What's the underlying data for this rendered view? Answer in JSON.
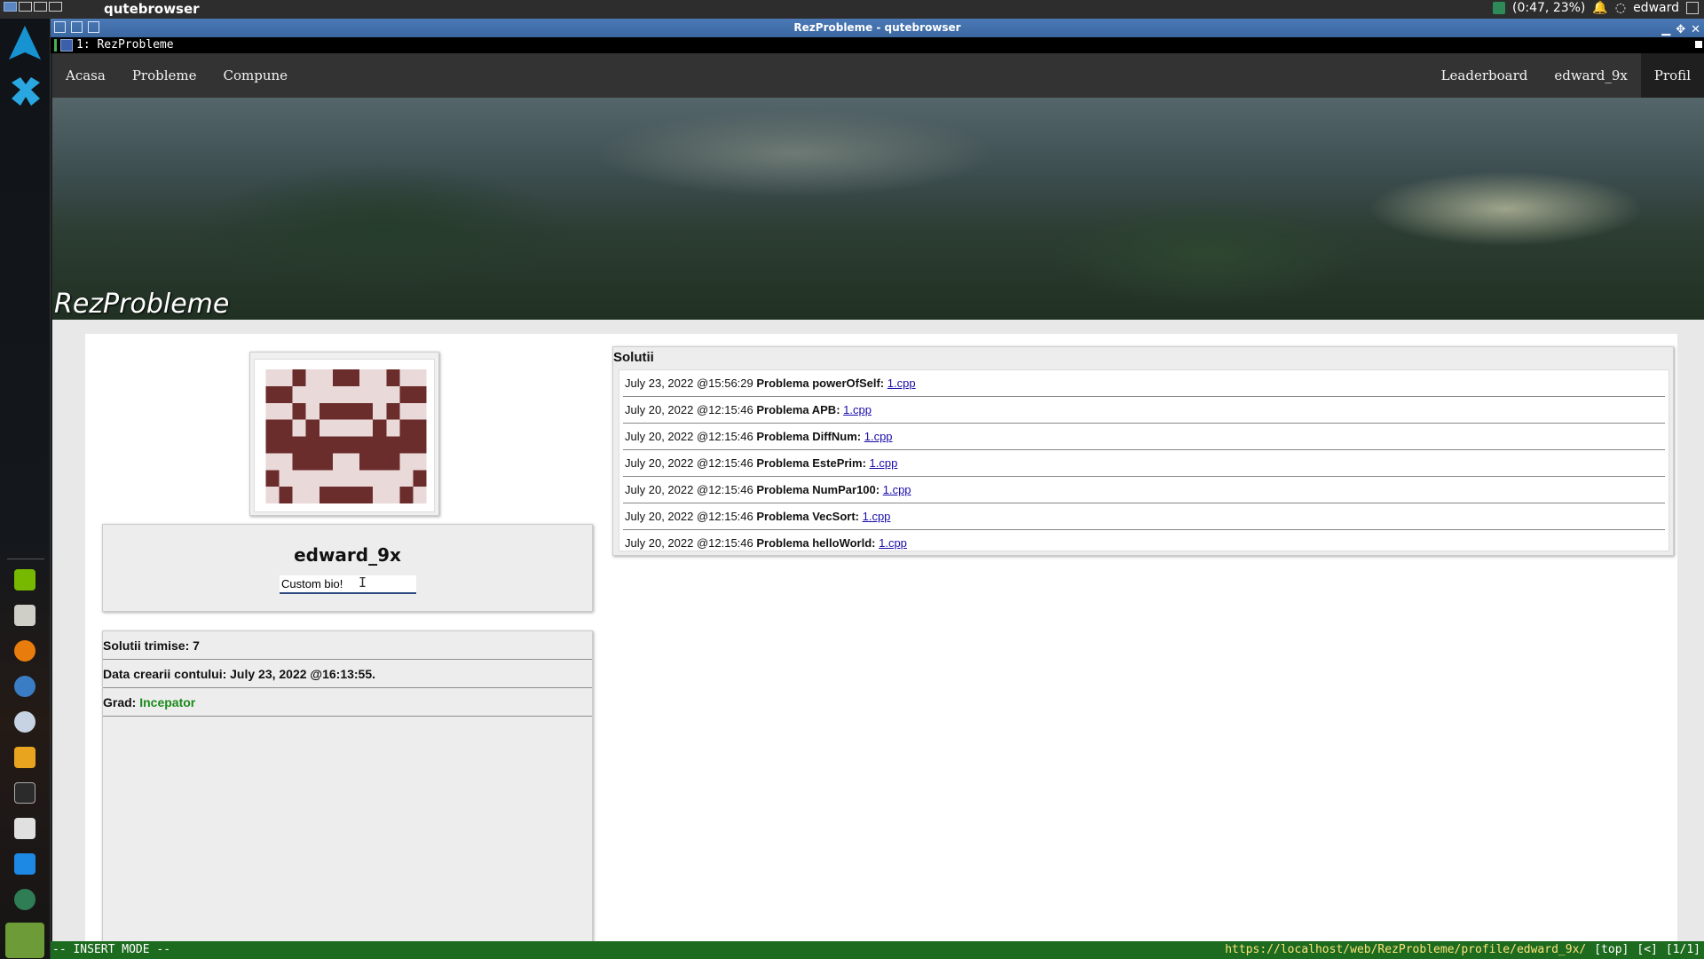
{
  "system": {
    "app_name": "qutebrowser",
    "battery": "(0:47, 23%)",
    "user": "edward"
  },
  "window": {
    "title": "RezProbleme - qutebrowser",
    "tab_label": "1: RezProbleme"
  },
  "nav": {
    "left": [
      "Acasa",
      "Probleme",
      "Compune"
    ],
    "right": [
      "Leaderboard",
      "edward_9x",
      "Profil"
    ]
  },
  "banner": {
    "site_title": "RezProbleme"
  },
  "profile": {
    "username": "edward_9x",
    "bio_value": "Custom bio!",
    "stats": {
      "solutions_label": "Solutii trimise: 7",
      "created_label": "Data crearii contului: July 23, 2022 @16:13:55.",
      "grade_label": "Grad:",
      "grade_value": "Incepator"
    }
  },
  "solutions": {
    "heading": "Solutii",
    "items": [
      {
        "time": "July 23, 2022 @15:56:29",
        "problem": "Problema powerOfSelf:",
        "file": "1.cpp"
      },
      {
        "time": "July 20, 2022 @12:15:46",
        "problem": "Problema APB:",
        "file": "1.cpp"
      },
      {
        "time": "July 20, 2022 @12:15:46",
        "problem": "Problema DiffNum:",
        "file": "1.cpp"
      },
      {
        "time": "July 20, 2022 @12:15:46",
        "problem": "Problema EstePrim:",
        "file": "1.cpp"
      },
      {
        "time": "July 20, 2022 @12:15:46",
        "problem": "Problema NumPar100:",
        "file": "1.cpp"
      },
      {
        "time": "July 20, 2022 @12:15:46",
        "problem": "Problema VecSort:",
        "file": "1.cpp"
      },
      {
        "time": "July 20, 2022 @12:15:46",
        "problem": "Problema helloWorld:",
        "file": "1.cpp"
      }
    ]
  },
  "statusbar": {
    "mode": "-- INSERT MODE --",
    "url": "https://localhost/web/RezProbleme/profile/edward_9x/",
    "position": "[top]",
    "history": "[<]",
    "tabs": "[1/1]"
  },
  "colors": {
    "accent_green": "#1b8a1b",
    "titlebar_blue": "#4a79b6",
    "statusbar_green": "#1c6b1f",
    "avatar_color": "#6b2d2b"
  },
  "icons": {
    "dock": [
      "arch-logo-icon",
      "apps-icon",
      "nvidia-icon",
      "disk-icon",
      "blender-icon",
      "atom-icon",
      "steam-icon",
      "files-icon",
      "terminal-icon",
      "window-icon",
      "display-icon",
      "lock-icon",
      "trash-icon"
    ]
  }
}
